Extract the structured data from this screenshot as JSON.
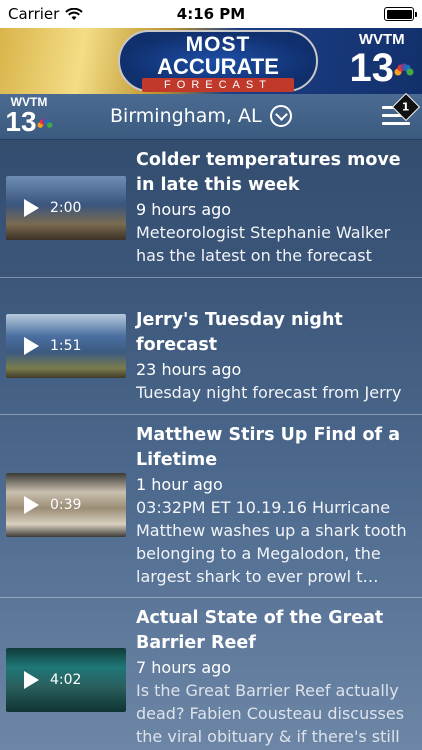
{
  "status_bar": {
    "carrier": "Carrier",
    "time": "4:16 PM"
  },
  "banner": {
    "line1": "MOST",
    "line2": "ACCURATE",
    "line3": "FORECAST",
    "logo_call": "WVTM",
    "logo_num": "13"
  },
  "nav": {
    "logo_call": "WVTM",
    "logo_num": "13",
    "location": "Birmingham, AL",
    "menu_badge": "1"
  },
  "videos": [
    {
      "title": "Colder temperatures move in late this week",
      "duration": "2:00",
      "time": "9 hours ago",
      "desc": "Meteorologist Stephanie Walker has the latest on the forecast"
    },
    {
      "title": "Jerry's Tuesday night forecast",
      "duration": "1:51",
      "time": "23 hours ago",
      "desc": "Tuesday night forecast from Jerry"
    },
    {
      "title": "Matthew Stirs Up Find of a Lifetime",
      "duration": "0:39",
      "time": "1 hour ago",
      "desc": "03:32PM ET 10.19.16 Hurricane Matthew washes up a shark tooth belonging to a Megalodon, the largest shark to ever prowl t…"
    },
    {
      "title": "Actual State of the Great Barrier Reef",
      "duration": "4:02",
      "time": "7 hours ago",
      "desc": "Is the Great Barrier Reef actually dead? Fabien Cousteau discusses the viral obituary & if there's still"
    }
  ]
}
